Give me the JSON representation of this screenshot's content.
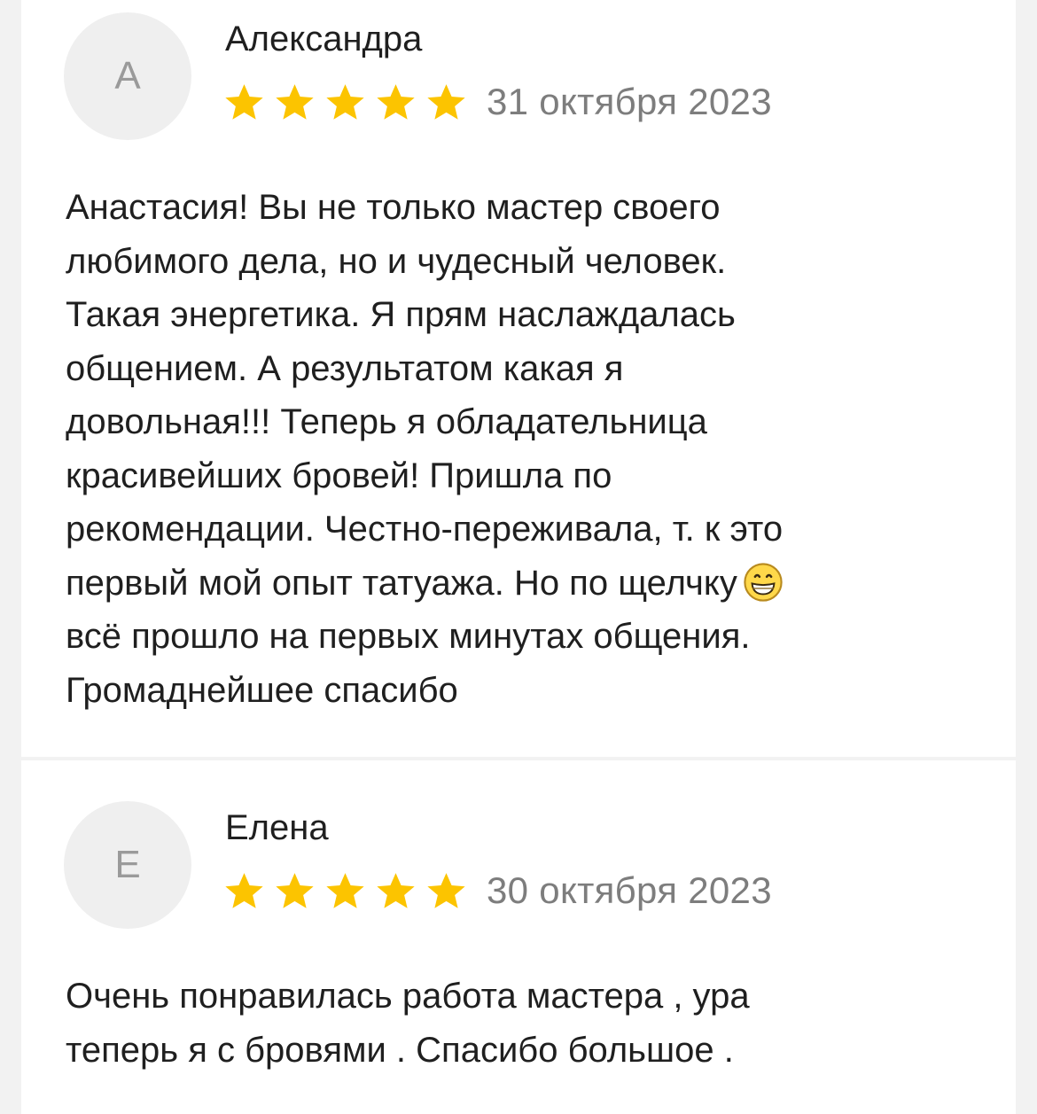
{
  "reviews": [
    {
      "avatar_letter": "А",
      "author": "Александра",
      "rating": 5,
      "rating_max": 5,
      "date": "31 октября 2023",
      "text_before_emoji": "Анастасия! Вы не только мастер своего\nлюбимого дела, но и чудесный человек.\nТакая энергетика. Я прям наслаждалась\nобщением. А результатом какая я\nдовольная!!! Теперь я обладательница\nкрасивейших бровей! Пришла по\nрекомендации. Честно-переживала, т. к это\nпервый мой опыт татуажа. Но по щелчку",
      "emoji": "grinning-face-icon",
      "text_after_emoji": "\nвсё прошло на первых минутах общения.\nГромаднейшее спасибо"
    },
    {
      "avatar_letter": "Е",
      "author": "Елена",
      "rating": 5,
      "rating_max": 5,
      "date": "30 октября 2023",
      "text": "Очень понравилась работа мастера , ура\nтеперь я с бровями . Спасибо большое ."
    }
  ],
  "colors": {
    "star": "#FCC400",
    "background": "#F2F2F2",
    "card": "#FFFFFF",
    "text": "#1F1F1F",
    "muted": "#7D7D7D",
    "avatar_bg": "#EFEFEF"
  }
}
